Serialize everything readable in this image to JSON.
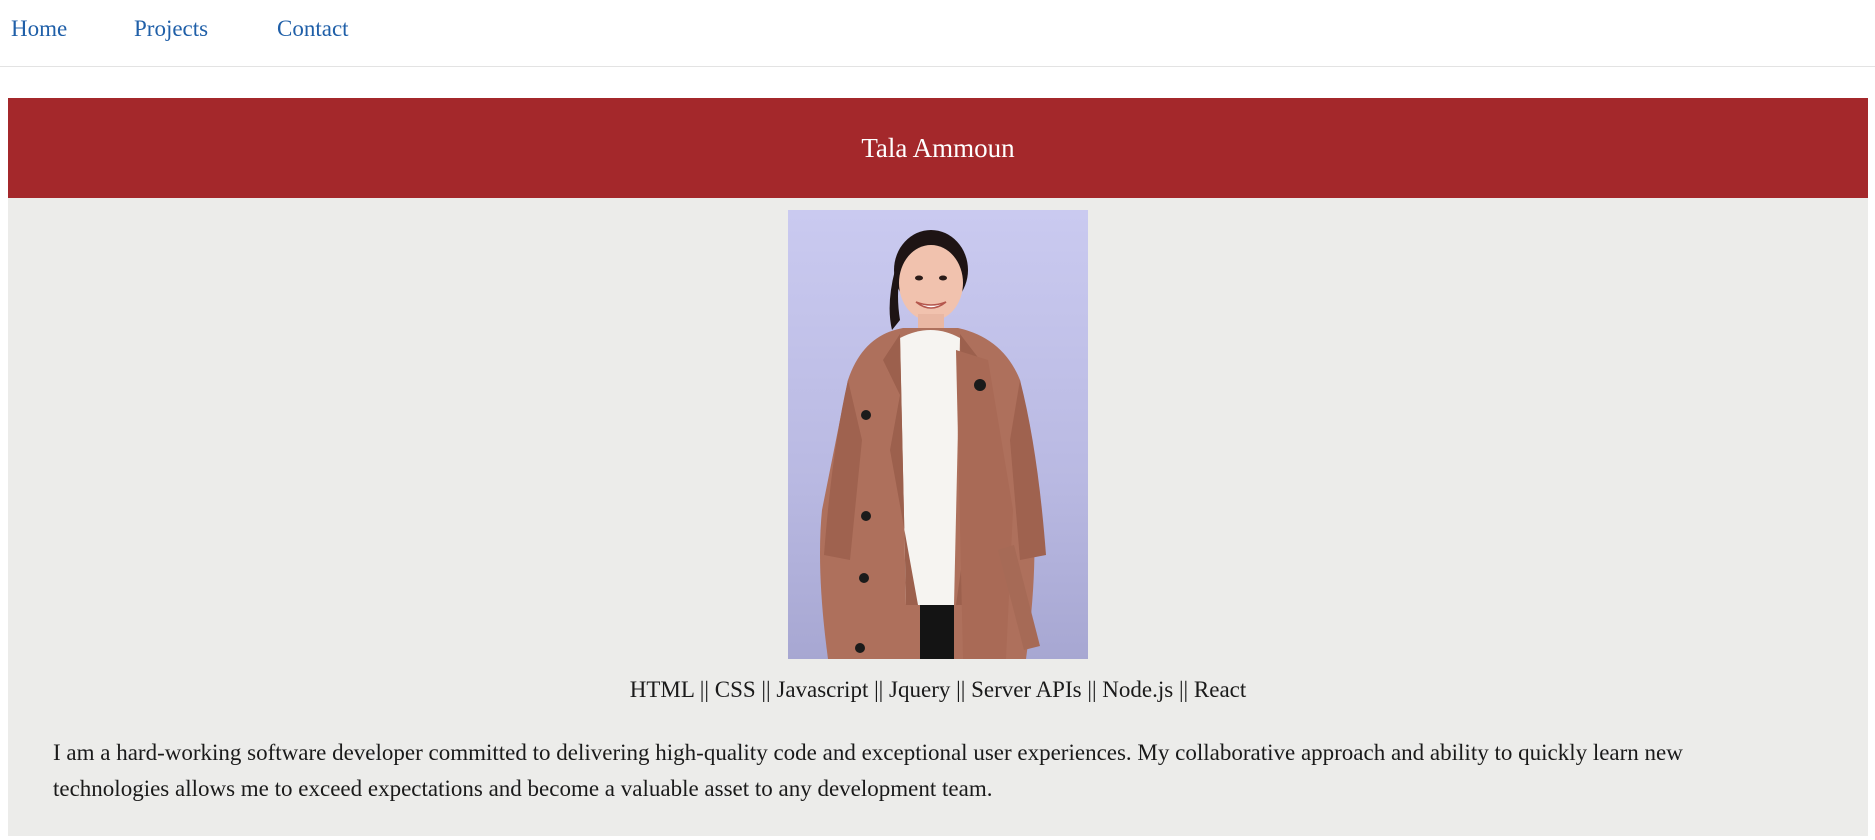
{
  "nav": {
    "home": "Home",
    "projects": "Projects",
    "contact": "Contact"
  },
  "header": {
    "name": "Tala Ammoun"
  },
  "profile": {
    "photo_alt": "Portrait photo"
  },
  "skills": "HTML || CSS || Javascript || Jquery || Server APIs || Node.js || React",
  "bio": "I am a hard-working software developer committed to delivering high-quality code and exceptional user experiences. My collaborative approach and ability to quickly learn new technologies allows me to exceed expectations and become a valuable asset to any development team.",
  "colors": {
    "nav_link": "#1f5fa8",
    "banner": "#a4282b",
    "card_background": "#ececea"
  }
}
